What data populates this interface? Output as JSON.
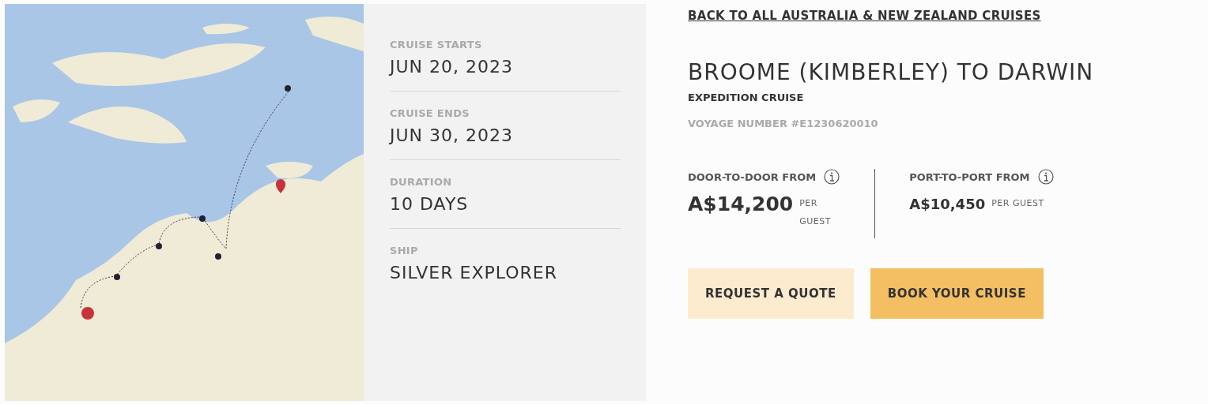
{
  "details": [
    {
      "label": "CRUISE STARTS",
      "value": "JUN 20, 2023"
    },
    {
      "label": "CRUISE ENDS",
      "value": "JUN 30, 2023"
    },
    {
      "label": "DURATION",
      "value": "10 DAYS"
    },
    {
      "label": "SHIP",
      "value": "SILVER EXPLORER"
    }
  ],
  "back_link": "BACK TO ALL AUSTRALIA & NEW ZEALAND CRUISES",
  "title": "BROOME (KIMBERLEY) TO DARWIN",
  "subtitle": "EXPEDITION CRUISE",
  "voyage_number": "VOYAGE NUMBER #E1230620010",
  "prices": [
    {
      "label": "DOOR-TO-DOOR FROM",
      "amount": "A$14,200",
      "unit": "PER GUEST",
      "kind": "wrapped"
    },
    {
      "label": "PORT-TO-PORT FROM",
      "amount": "A$10,450",
      "unit": "PER GUEST",
      "kind": "inline"
    }
  ],
  "buttons": [
    {
      "label": "REQUEST A QUOTE",
      "kind": "secondary"
    },
    {
      "label": "BOOK YOUR CRUISE",
      "kind": "primary"
    }
  ]
}
